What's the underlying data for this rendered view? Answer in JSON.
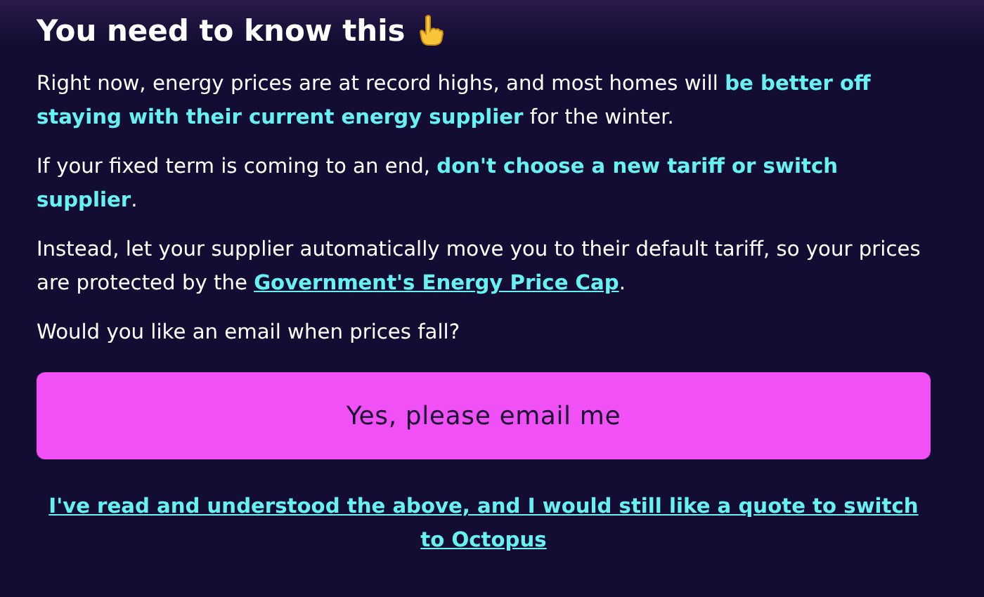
{
  "title": "You need to know this",
  "paragraphs": [
    {
      "kind": "rich",
      "text": "Right now, energy prices are at record highs, and most homes will **be better off staying with their current energy supplier** for the winter."
    },
    {
      "kind": "rich",
      "text": "If your fixed term is coming to an end, **don't choose a new tariff or switch supplier**."
    },
    {
      "kind": "link",
      "before": "Instead, let your supplier automatically move you to their default tariff, so your prices are protected by the ",
      "link": "Government's Energy Price Cap",
      "after": "."
    },
    {
      "kind": "rich",
      "text": "Would you like an email when prices fall?"
    }
  ],
  "button": "Yes, please email me",
  "footer_link": "I've read and understood the above, and I would still like a quote to switch to Octopus"
}
